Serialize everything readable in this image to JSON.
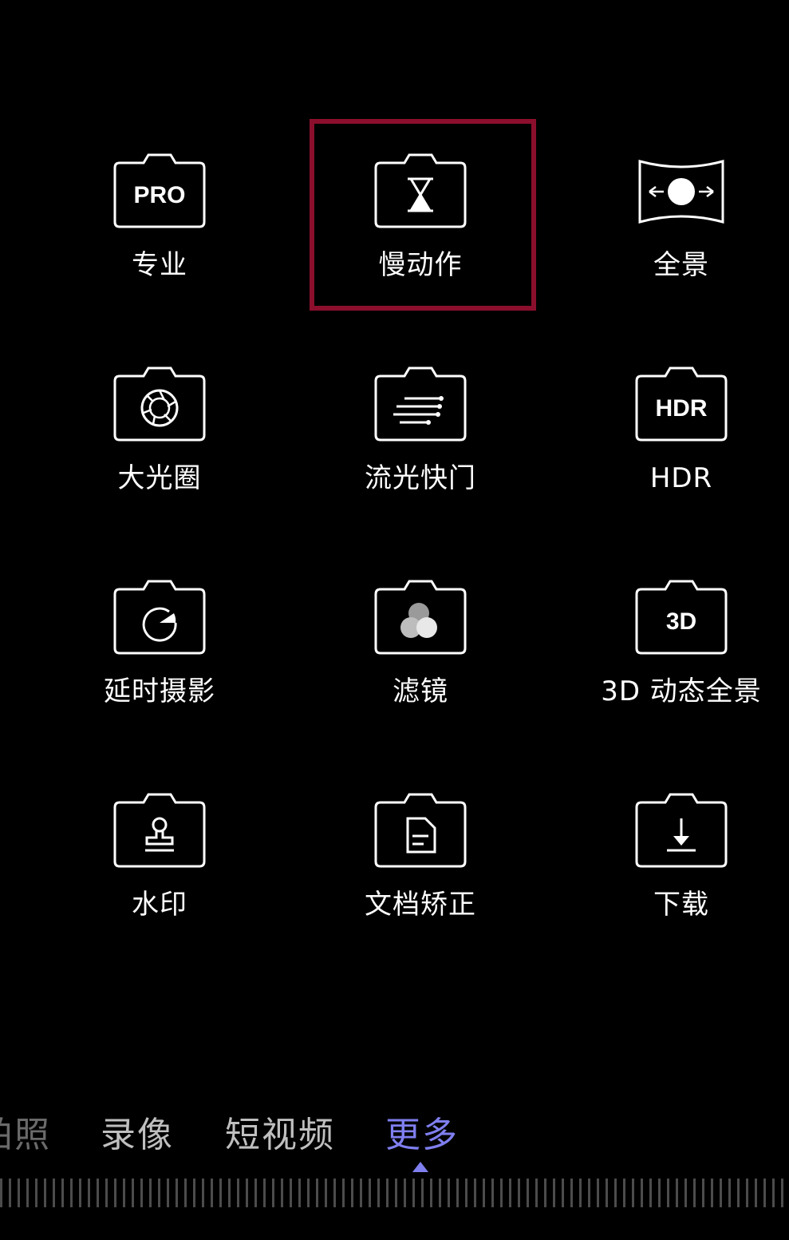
{
  "modes": [
    {
      "id": "pro",
      "label": "专业",
      "icon": "pro-icon",
      "icon_text": "PRO"
    },
    {
      "id": "slowmo",
      "label": "慢动作",
      "icon": "hourglass-icon",
      "selected": true
    },
    {
      "id": "panorama",
      "label": "全景",
      "icon": "panorama-icon"
    },
    {
      "id": "aperture",
      "label": "大光圈",
      "icon": "aperture-icon"
    },
    {
      "id": "light-painting",
      "label": "流光快门",
      "icon": "light-trails-icon"
    },
    {
      "id": "hdr",
      "label": "HDR",
      "icon": "hdr-icon",
      "icon_text": "HDR"
    },
    {
      "id": "timelapse",
      "label": "延时摄影",
      "icon": "timelapse-icon"
    },
    {
      "id": "filter",
      "label": "滤镜",
      "icon": "filter-icon"
    },
    {
      "id": "3d-panorama",
      "label": "3D 动态全景",
      "icon": "3d-icon",
      "icon_text": "3D"
    },
    {
      "id": "watermark",
      "label": "水印",
      "icon": "stamp-icon"
    },
    {
      "id": "document",
      "label": "文档矫正",
      "icon": "document-icon"
    },
    {
      "id": "download",
      "label": "下载",
      "icon": "download-icon"
    }
  ],
  "tabs": [
    {
      "label": "拍照"
    },
    {
      "label": "录像"
    },
    {
      "label": "短视频"
    },
    {
      "label": "更多",
      "active": true
    }
  ],
  "colors": {
    "background": "#000000",
    "selection_border": "#8b0f2c",
    "active_tab": "#7f7ff0",
    "inactive_tab": "#bfbfbf"
  }
}
